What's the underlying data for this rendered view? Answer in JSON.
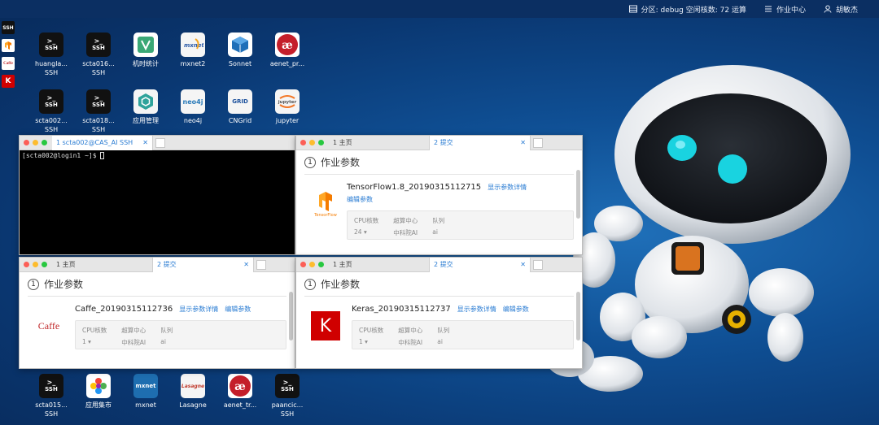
{
  "topbar": {
    "partition": "分区: debug 空闲核数: 72 运算",
    "job_center": "作业中心",
    "user": "胡敏杰"
  },
  "dock": [
    {
      "label": "SSH"
    },
    {
      "label": ""
    },
    {
      "label": "Caffe"
    },
    {
      "label": "K"
    }
  ],
  "desktop": {
    "row1": [
      {
        "name": "huangla...",
        "sub": "SSH",
        "type": "ssh"
      },
      {
        "name": "scta016...",
        "sub": "SSH",
        "type": "ssh"
      },
      {
        "name": "机时统计",
        "sub": "",
        "type": "stats"
      },
      {
        "name": "mxnet2",
        "sub": "",
        "type": "mxnet"
      },
      {
        "name": "Sonnet",
        "sub": "",
        "type": "sonnet"
      },
      {
        "name": "aenet_pr...",
        "sub": "",
        "type": "ae"
      }
    ],
    "row2": [
      {
        "name": "scta002...",
        "sub": "SSH",
        "type": "ssh"
      },
      {
        "name": "scta018...",
        "sub": "SSH",
        "type": "ssh"
      },
      {
        "name": "应用管理",
        "sub": "",
        "type": "app"
      },
      {
        "name": "neo4j",
        "sub": "",
        "type": "neo4j"
      },
      {
        "name": "CNGrid",
        "sub": "",
        "type": "grid"
      },
      {
        "name": "jupyter",
        "sub": "",
        "type": "jupyter"
      }
    ],
    "row3": [
      {
        "name": "scta015...",
        "sub": "SSH",
        "type": "ssh"
      },
      {
        "name": "应用集市",
        "sub": "",
        "type": "market"
      },
      {
        "name": "mxnet",
        "sub": "",
        "type": "mxnetc"
      },
      {
        "name": "Lasagne",
        "sub": "",
        "type": "lasagne"
      },
      {
        "name": "aenet_tr...",
        "sub": "",
        "type": "ae"
      },
      {
        "name": "paancic...",
        "sub": "SSH",
        "type": "ssh"
      }
    ],
    "ssh_label": "SSH",
    "ssh_prompt": ">_",
    "grid_text": "GRID",
    "jupyter_text": "jupyter",
    "neo_text": "neo4j",
    "mxnet_text": "mxnet",
    "lasagne_text": "Lasagne",
    "ae_text": "æ"
  },
  "terminal": {
    "tab_label": "1 scta002@CAS_AI SSH",
    "prompt": "[scta002@login1 ~]$ "
  },
  "jobs": [
    {
      "id": "tf",
      "tab_home": "1 主页",
      "tab_submit": "2 提交",
      "step_num": "1",
      "step_title": "作业参数",
      "name": "TensorFlow1.8_20190315112715",
      "link_detail": "显示参数详情",
      "link_edit": "编辑参数",
      "logo_text": "TensorFlow",
      "params": {
        "cpu_label": "CPU核数",
        "cpu_value": "24",
        "center_label": "超算中心",
        "center_value": "中科院AI",
        "queue_label": "队列",
        "queue_value": "ai"
      }
    },
    {
      "id": "caffe",
      "tab_home": "1 主页",
      "tab_submit": "2 提交",
      "step_num": "1",
      "step_title": "作业参数",
      "name": "Caffe_20190315112736",
      "link_detail": "显示参数详情",
      "link_edit": "编辑参数",
      "logo_text": "Caffe",
      "params": {
        "cpu_label": "CPU核数",
        "cpu_value": "1",
        "center_label": "超算中心",
        "center_value": "中科院AI",
        "queue_label": "队列",
        "queue_value": "ai"
      }
    },
    {
      "id": "keras",
      "tab_home": "1 主页",
      "tab_submit": "2 提交",
      "step_num": "1",
      "step_title": "作业参数",
      "name": "Keras_20190315112737",
      "link_detail": "显示参数详情",
      "link_edit": "编辑参数",
      "logo_text": "K",
      "params": {
        "cpu_label": "CPU核数",
        "cpu_value": "1",
        "center_label": "超算中心",
        "center_value": "中科院AI",
        "queue_label": "队列",
        "queue_value": "ai"
      }
    }
  ],
  "colors": {
    "accent": "#2a7cd3",
    "desktop_bg": "#0f4f94",
    "keras_red": "#d00000",
    "caffe_red": "#c0282a"
  }
}
